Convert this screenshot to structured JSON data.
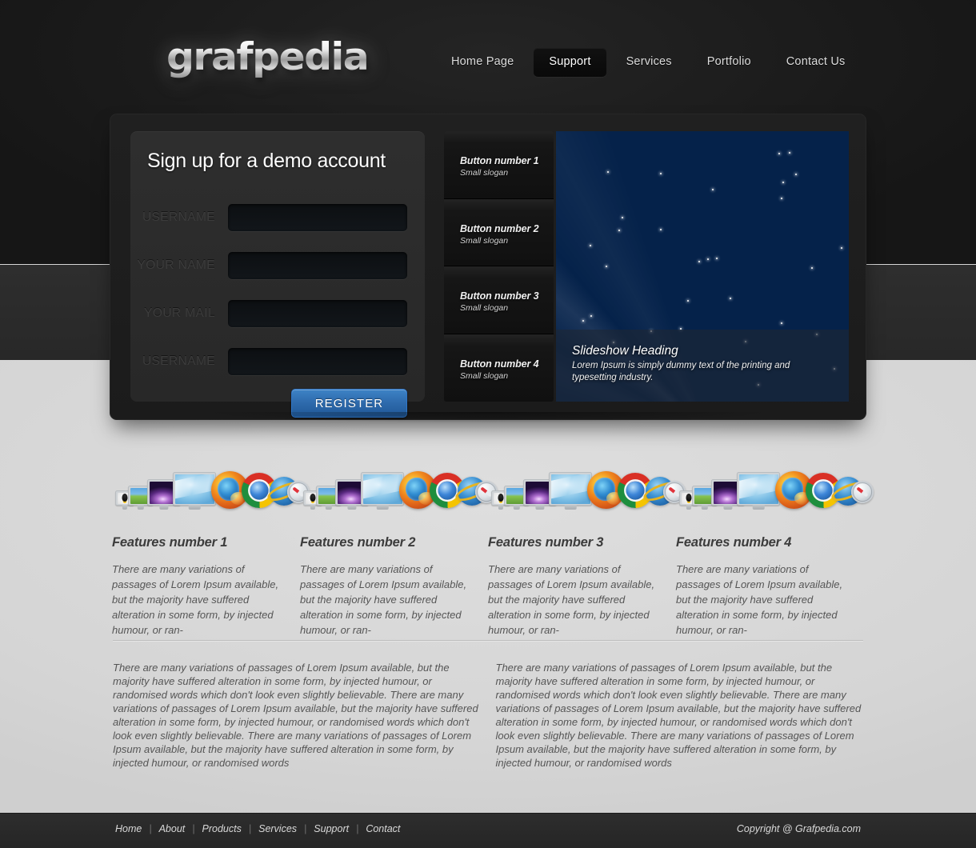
{
  "header": {
    "logo_text": "grafpedia",
    "nav": [
      {
        "label": "Home Page",
        "active": false
      },
      {
        "label": "Support",
        "active": true
      },
      {
        "label": "Services",
        "active": false
      },
      {
        "label": "Portfolio",
        "active": false
      },
      {
        "label": "Contact Us",
        "active": false
      }
    ]
  },
  "signup": {
    "title": "Sign up for a demo account",
    "fields": [
      {
        "label": "USERNAME",
        "value": "",
        "placeholder": ""
      },
      {
        "label": "YOUR NAME",
        "value": "",
        "placeholder": ""
      },
      {
        "label": "YOUR MAIL",
        "value": "",
        "placeholder": ""
      },
      {
        "label": "USERNAME",
        "value": "",
        "placeholder": ""
      }
    ],
    "submit_label": "REGISTER",
    "accent_color": "#2f6cae"
  },
  "slideshow": {
    "buttons": [
      {
        "title": "Button number 1",
        "slogan": "Small slogan"
      },
      {
        "title": "Button number 2",
        "slogan": "Small slogan"
      },
      {
        "title": "Button number 3",
        "slogan": "Small slogan"
      },
      {
        "title": "Button number 4",
        "slogan": "Small slogan"
      }
    ],
    "caption": {
      "heading": "Slideshow Heading",
      "text": "Lorem Ipsum is simply dummy text of the printing and typesetting industry."
    },
    "image_name": "blue-aurora-starfield-wallpaper"
  },
  "features": [
    {
      "title": "Features number 1",
      "text": "There are many variations of passages of Lorem Ipsum available, but the majority have suffered alteration in some form, by injected humour, or ran-",
      "art_name": "browsers-and-monitors-icon-row"
    },
    {
      "title": "Features number 2",
      "text": "There are many variations of passages of Lorem Ipsum available, but the majority have suffered alteration in some form, by injected humour, or ran-",
      "art_name": "browsers-and-monitors-icon-row"
    },
    {
      "title": "Features number 3",
      "text": "There are many variations of passages of Lorem Ipsum available, but the majority have suffered alteration in some form, by injected humour, or ran-",
      "art_name": "browsers-and-monitors-icon-row"
    },
    {
      "title": "Features number 4",
      "text": "There are many variations of passages of Lorem Ipsum available, but the majority have suffered alteration in some form, by injected humour, or ran-",
      "art_name": "browsers-and-monitors-icon-row"
    }
  ],
  "bottom_columns": [
    "There are many variations of passages of Lorem Ipsum available, but the majority have suffered alteration in some form, by injected humour, or randomised words which don't look even slightly believable. There are many variations of passages of Lorem Ipsum available, but the majority have suffered alteration in some form, by injected humour, or randomised words which don't look even slightly believable. There are many variations of passages of Lorem Ipsum available, but the majority have suffered alteration in some form, by injected humour, or randomised words",
    "There are many variations of passages of Lorem Ipsum available, but the majority have suffered alteration in some form, by injected humour, or randomised words which don't look even slightly believable. There are many variations of passages of Lorem Ipsum available, but the majority have suffered alteration in some form, by injected humour, or randomised words which don't look even slightly believable. There are many variations of passages of Lorem Ipsum available, but the majority have suffered alteration in some form, by injected humour, or randomised words"
  ],
  "footer": {
    "links": [
      "Home",
      "About",
      "Products",
      "Services",
      "Support",
      "Contact"
    ],
    "separator": "|",
    "copyright": "Copyright @ Grafpedia.com"
  }
}
